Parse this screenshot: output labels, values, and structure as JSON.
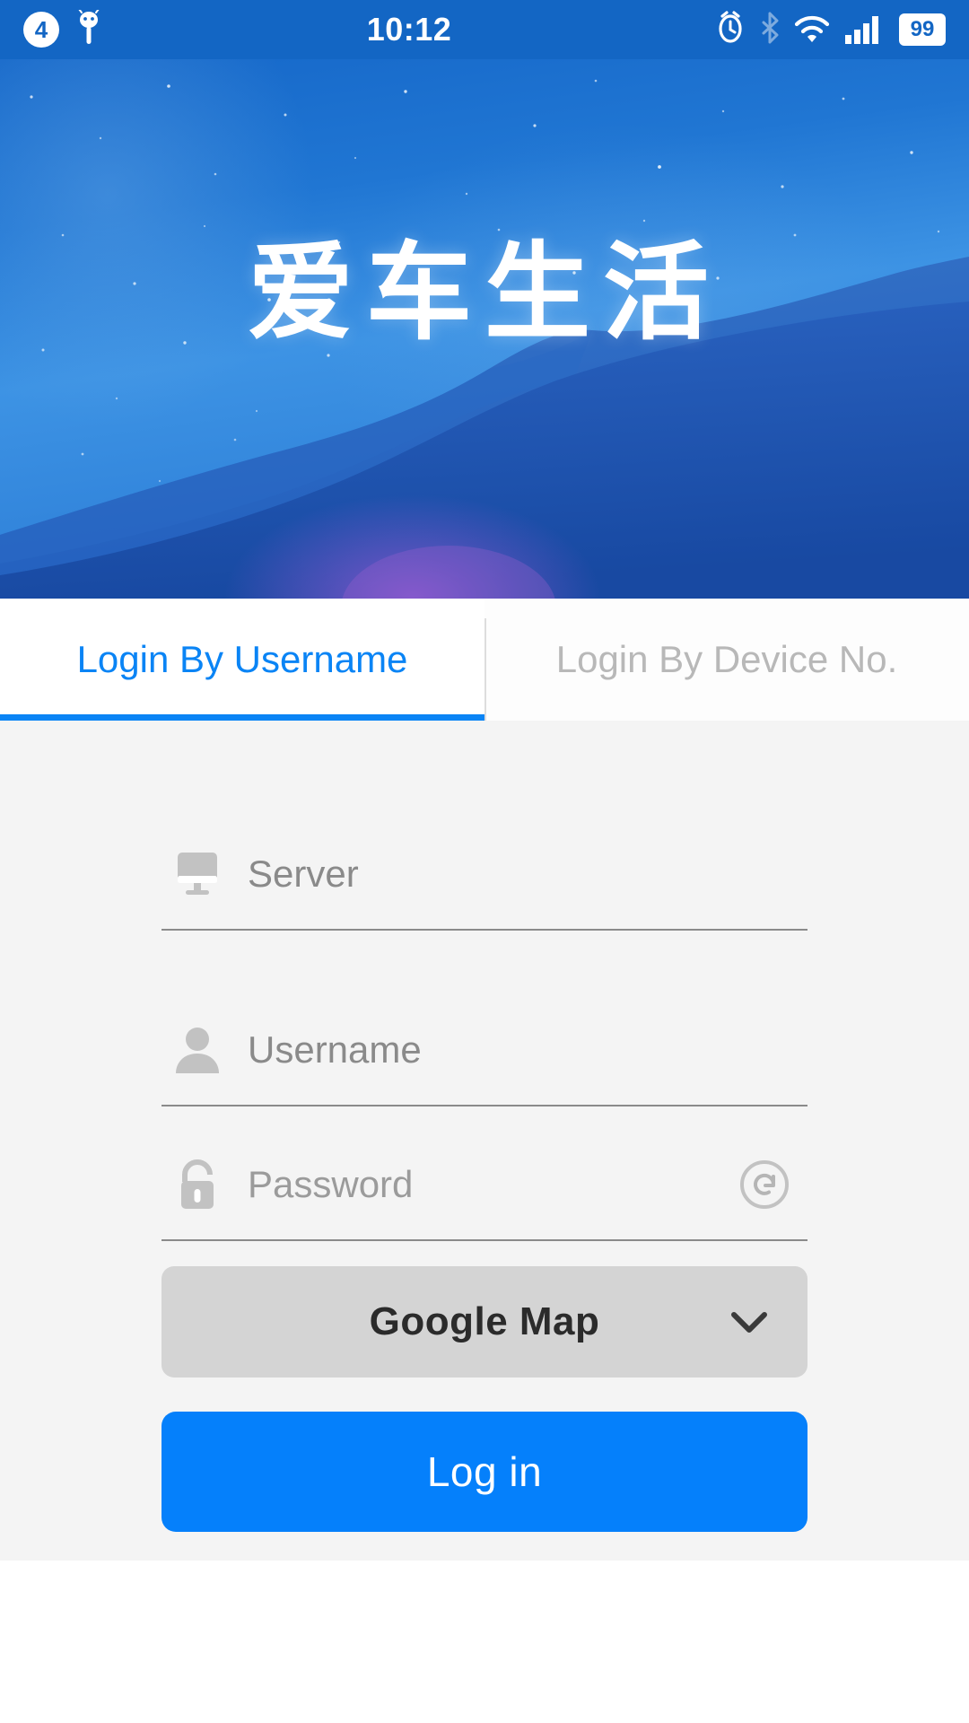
{
  "status_bar": {
    "notification_count": "4",
    "time": "10:12",
    "battery_level": "99",
    "icons": {
      "android_robot": "android-robot-icon",
      "alarm": "alarm-clock-icon",
      "bluetooth": "bluetooth-icon",
      "wifi": "wifi-icon",
      "signal": "cellular-signal-icon",
      "battery": "battery-icon"
    }
  },
  "banner": {
    "app_logo_text": "爱车生活",
    "car_emblem": "car-silhouette-icon"
  },
  "tabs": [
    {
      "label": "Login By Username",
      "active": true
    },
    {
      "label": "Login By Device No.",
      "active": false
    }
  ],
  "form": {
    "server": {
      "placeholder": "Server",
      "value": "",
      "icon": "monitor-icon"
    },
    "username": {
      "placeholder": "Username",
      "value": "",
      "icon": "user-icon"
    },
    "password": {
      "placeholder": "Password",
      "value": "",
      "icon": "lock-icon",
      "action_icon": "refresh-icon"
    },
    "map_select": {
      "selected": "Google Map",
      "chevron": "chevron-down-icon"
    },
    "login_button": {
      "label": "Log in"
    }
  },
  "colors": {
    "status_bar": "#1366C4",
    "accent_blue": "#0a84f5",
    "login_button": "#0580fb",
    "dropdown_bg": "#d4d4d4",
    "form_bg": "#f4f4f4",
    "placeholder_text": "#8a8a8a",
    "inactive_tab_text": "#b8b8b8"
  }
}
